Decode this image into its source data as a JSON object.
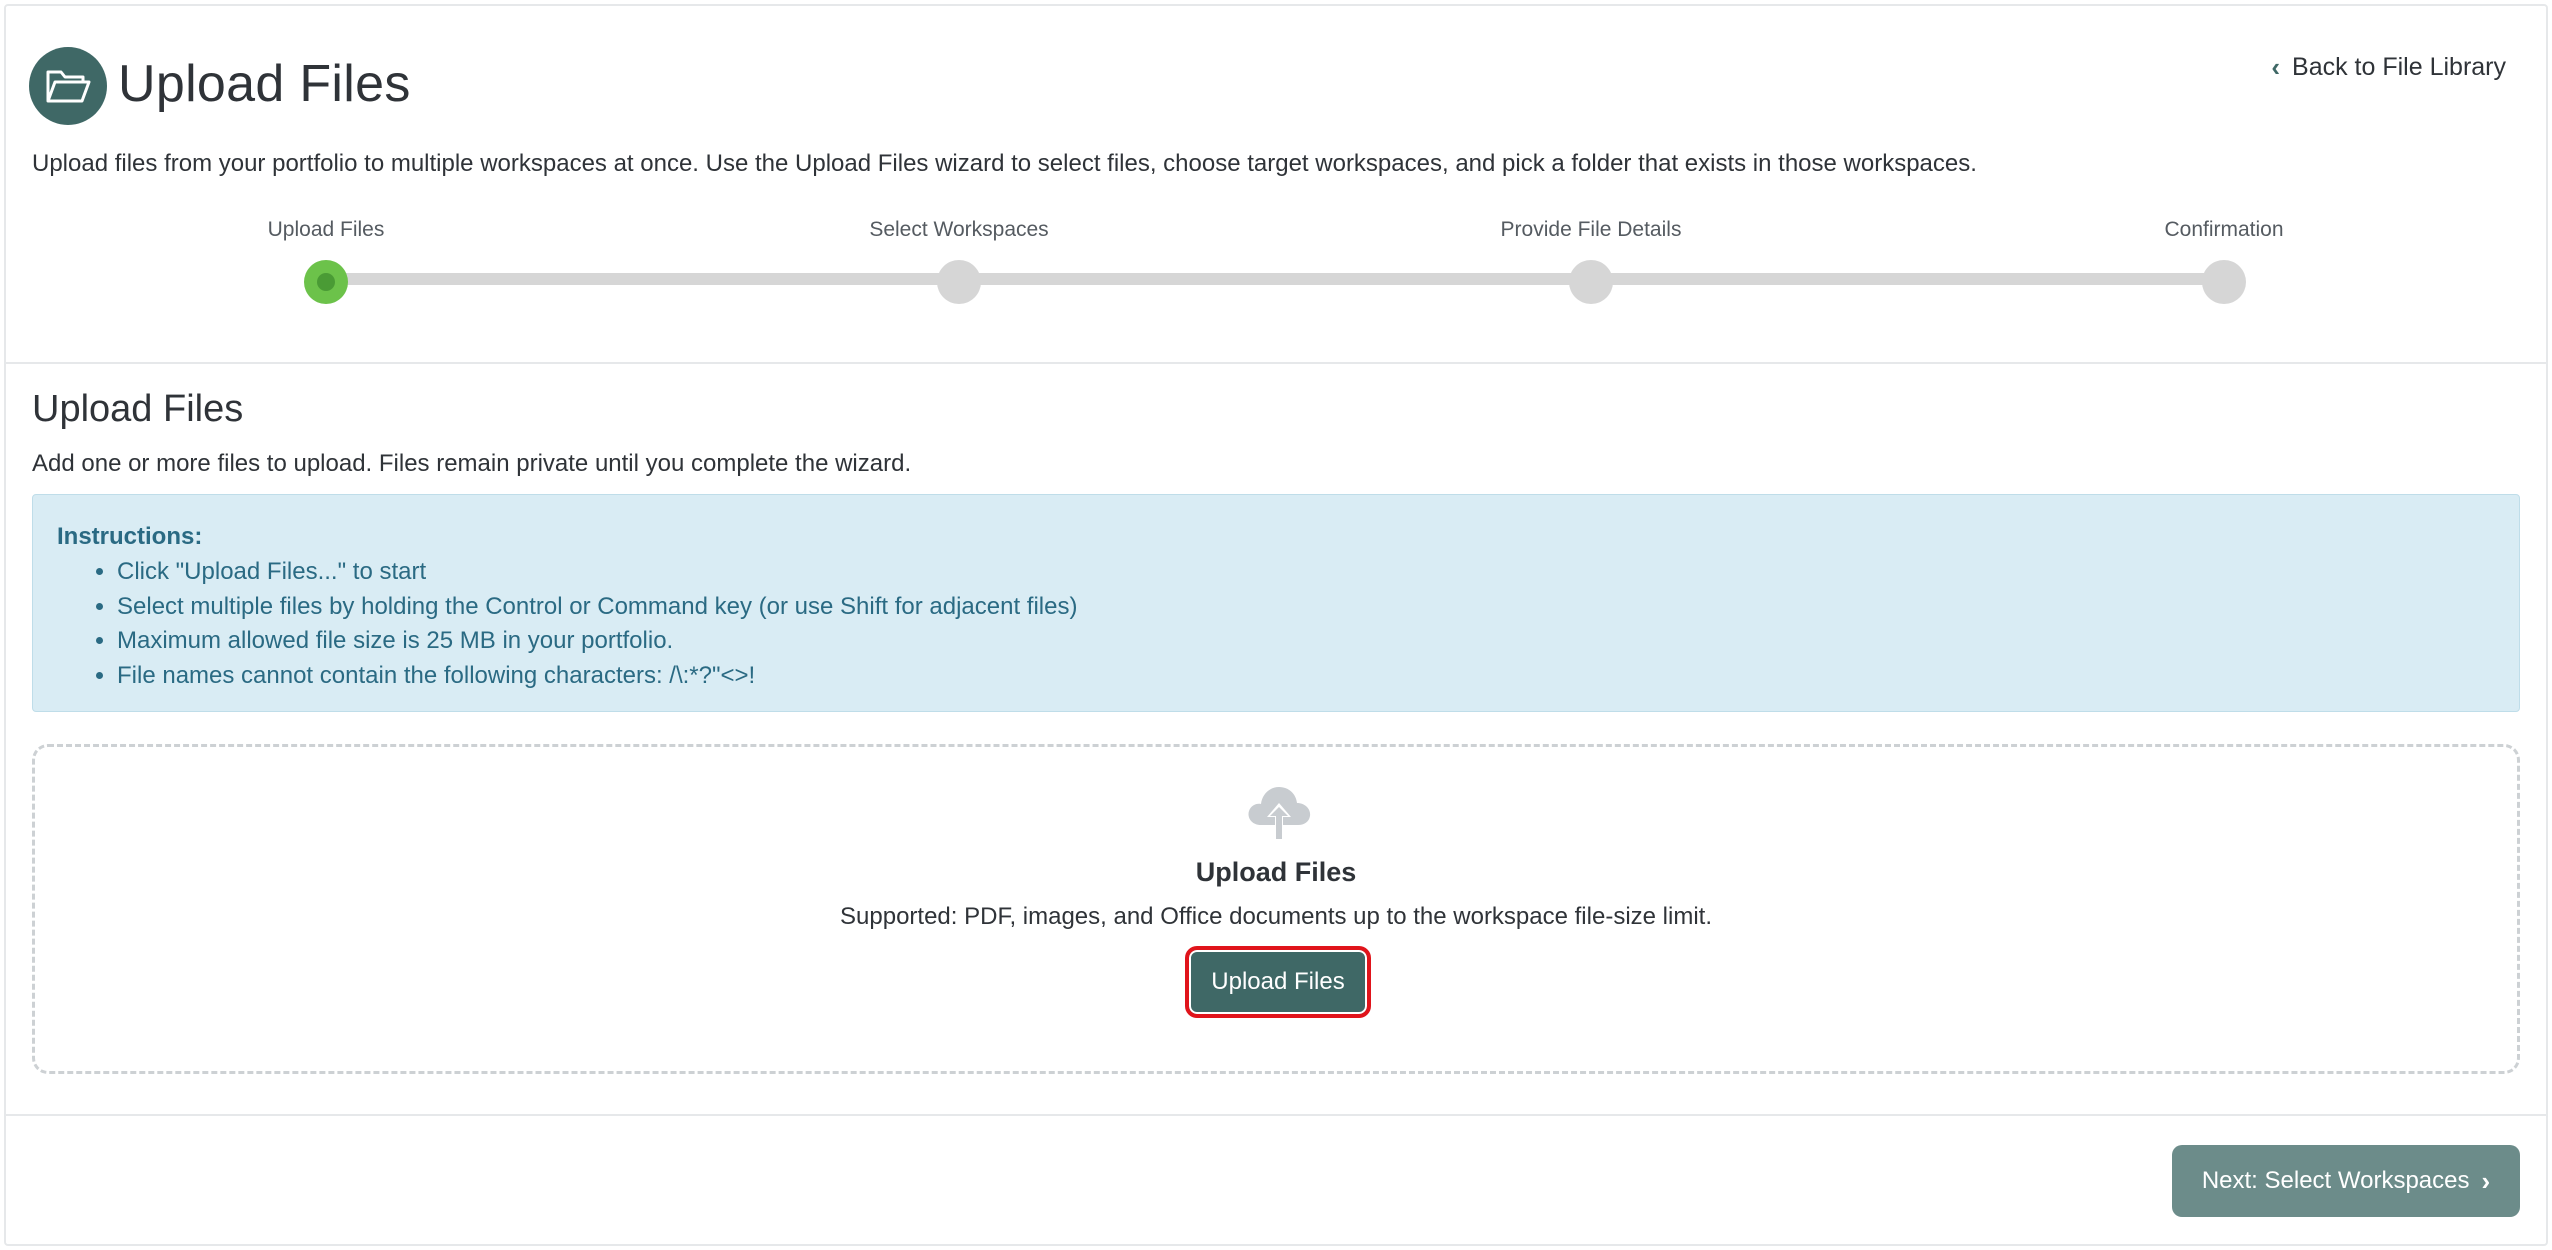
{
  "header": {
    "title": "Upload Files",
    "icon": "folder-open-icon",
    "back_link": "Back to File Library",
    "intro": "Upload files from your portfolio to multiple workspaces at once. Use the Upload Files wizard to select files, choose target workspaces, and pick a folder that exists in those workspaces."
  },
  "stepper": {
    "steps": [
      {
        "label": "Upload Files",
        "state": "active"
      },
      {
        "label": "Select Workspaces",
        "state": "pending"
      },
      {
        "label": "Provide File Details",
        "state": "pending"
      },
      {
        "label": "Confirmation",
        "state": "pending"
      }
    ]
  },
  "section": {
    "title": "Upload Files",
    "description": "Add one or more files to upload. Files remain private until you complete the wizard."
  },
  "instructions": {
    "title": "Instructions:",
    "items": [
      "Click \"Upload Files...\" to start",
      "Select multiple files by holding the Control or Command key (or use Shift for adjacent files)",
      "Maximum allowed file size is 25 MB in your portfolio.",
      "File names cannot contain the following characters: /\\:*?\"<>!"
    ]
  },
  "dropzone": {
    "icon": "cloud-upload-icon",
    "title": "Upload Files",
    "subtitle": "Supported: PDF, images, and Office documents up to the workspace file-size limit.",
    "button_label": "Upload Files"
  },
  "footer": {
    "next_label": "Next: Select Workspaces"
  },
  "colors": {
    "accent": "#3f6866",
    "step_active": "#6cc24a",
    "info_bg": "#d9ecf4",
    "info_text": "#2a6a83",
    "highlight_border": "#e0141b"
  }
}
